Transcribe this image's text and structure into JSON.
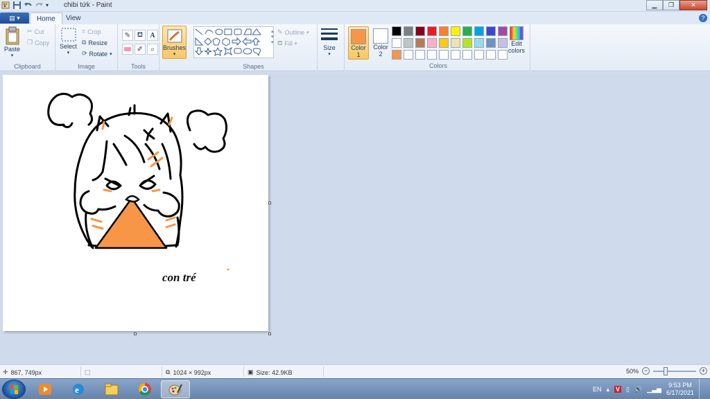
{
  "window": {
    "title": "chibi tứk - Paint"
  },
  "tabs": {
    "file_label": "▤ ▾",
    "home": "Home",
    "view": "View"
  },
  "clipboard": {
    "paste": "Paste",
    "cut": "Cut",
    "copy": "Copy",
    "label": "Clipboard"
  },
  "image": {
    "select": "Select",
    "crop": "Crop",
    "resize": "Resize",
    "rotate": "Rotate",
    "label": "Image"
  },
  "tools": {
    "label": "Tools",
    "text_tool": "A"
  },
  "brushes": {
    "label": "Brushes"
  },
  "shapes": {
    "outline": "Outline",
    "fill": "Fill",
    "label": "Shapes"
  },
  "size": {
    "label": "Size"
  },
  "colors": {
    "color1_label": "Color",
    "color1_num": "1",
    "color2_label": "Color",
    "color2_num": "2",
    "color1": "#f79646",
    "color2": "#ffffff",
    "edit_label_1": "Edit",
    "edit_label_2": "colors",
    "label": "Colors",
    "palette": [
      "#000000",
      "#7f7f7f",
      "#880015",
      "#ed1c24",
      "#ff7f27",
      "#fff200",
      "#22b14c",
      "#00a2e8",
      "#3f48cc",
      "#a349a4",
      "#ffffff",
      "#c3c3c3",
      "#b97a57",
      "#ffaec9",
      "#ffc90e",
      "#efe4b0",
      "#b5e61d",
      "#99d9ea",
      "#7092be",
      "#c8bfe7",
      "#f79646",
      "#ffffff",
      "#ffffff",
      "#ffffff",
      "#ffffff",
      "#ffffff",
      "#ffffff",
      "#ffffff",
      "#ffffff",
      "#ffffff"
    ]
  },
  "canvas": {
    "signature": "con tré"
  },
  "status": {
    "cursor_pos": "867, 749px",
    "image_size": "1024 × 992px",
    "file_size": "Size: 42.9KB",
    "zoom": "50%"
  },
  "tray": {
    "lang": "EN",
    "time": "9:53 PM",
    "date": "6/17/2021"
  }
}
